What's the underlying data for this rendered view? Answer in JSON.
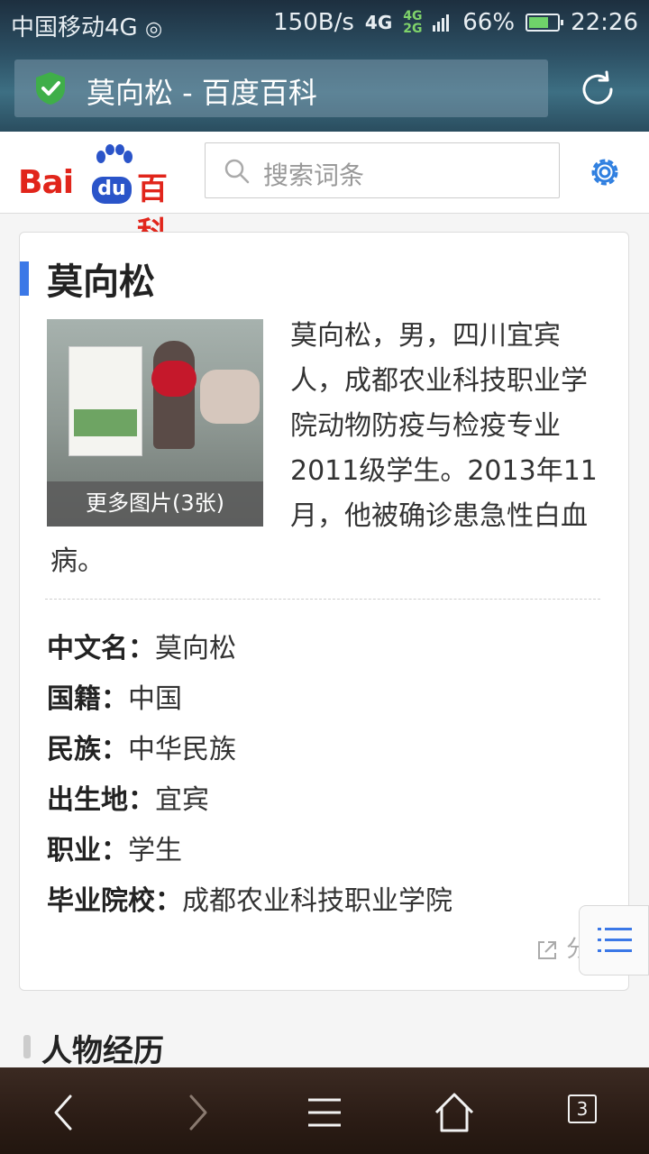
{
  "status_bar": {
    "carrier": "中国移动4G",
    "speed": "150B/s",
    "network": "4G",
    "network_sub": "4G 2G",
    "battery": "66%",
    "time": "22:26"
  },
  "browser": {
    "page_title": "莫向松 - 百度百科",
    "tab_count": "3"
  },
  "header": {
    "logo_bai": "Bai",
    "logo_du": "du",
    "logo_baike": "百科",
    "search_placeholder": "搜索词条"
  },
  "article": {
    "title": "莫向松",
    "more_images": "更多图片(3张)",
    "summary": "莫向松，男，四川宜宾人，成都农业科技职业学院动物防疫与检疫专业2011级学生。2013年11月，他被确诊患急性白血病。",
    "info": [
      {
        "key": "中文名：",
        "value": "莫向松"
      },
      {
        "key": "国籍：",
        "value": "中国"
      },
      {
        "key": "民族：",
        "value": "中华民族"
      },
      {
        "key": "出生地：",
        "value": "宜宾"
      },
      {
        "key": "职业：",
        "value": "学生"
      },
      {
        "key": "毕业院校：",
        "value": "成都农业科技职业学院"
      }
    ],
    "share": "分享"
  },
  "section": {
    "title": "人物经历"
  },
  "colors": {
    "accent": "#3b78e7",
    "baidu_red": "#e1251b",
    "baidu_blue": "#2a54c9"
  }
}
